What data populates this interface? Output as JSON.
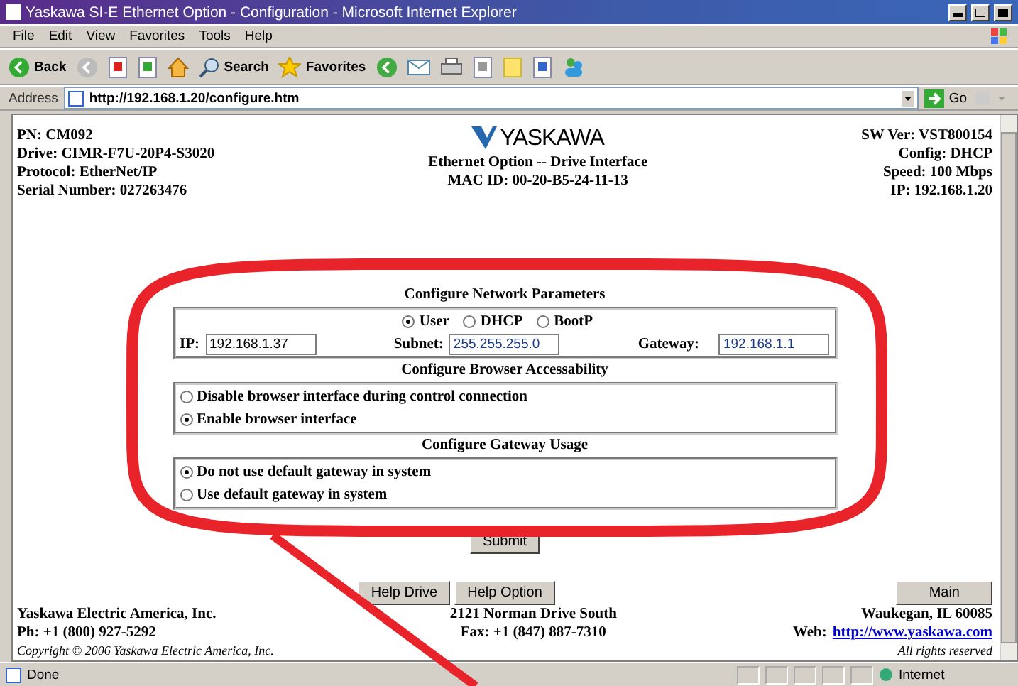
{
  "window": {
    "title": "Yaskawa SI-E Ethernet Option - Configuration - Microsoft Internet Explorer"
  },
  "menu": [
    "File",
    "Edit",
    "View",
    "Favorites",
    "Tools",
    "Help"
  ],
  "toolbar": {
    "back": "Back",
    "search": "Search",
    "favorites": "Favorites"
  },
  "address": {
    "label": "Address",
    "url": "http://192.168.1.20/configure.htm",
    "go": "Go"
  },
  "header": {
    "left": [
      "PN: CM092",
      "Drive: CIMR-F7U-20P4-S3020",
      "Protocol: EtherNet/IP",
      "Serial Number: 027263476"
    ],
    "logo": "YASKAWA",
    "center": [
      "Ethernet Option -- Drive Interface",
      "MAC ID: 00-20-B5-24-11-13"
    ],
    "right": [
      "SW Ver: VST800154",
      "Config: DHCP",
      "Speed: 100 Mbps",
      "IP: 192.168.1.20"
    ]
  },
  "network": {
    "title": "Configure Network Parameters",
    "modes": [
      {
        "label": "User",
        "selected": true
      },
      {
        "label": "DHCP",
        "selected": false
      },
      {
        "label": "BootP",
        "selected": false
      }
    ],
    "fields": [
      {
        "label": "IP:",
        "value": "192.168.1.37"
      },
      {
        "label": "Subnet:",
        "value": "255.255.255.0"
      },
      {
        "label": "Gateway:",
        "value": "192.168.1.1"
      }
    ]
  },
  "browser": {
    "title": "Configure Browser Accessability",
    "options": [
      {
        "label": "Disable browser interface during control connection",
        "selected": false
      },
      {
        "label": "Enable browser interface",
        "selected": true
      }
    ]
  },
  "gateway": {
    "title": "Configure Gateway Usage",
    "options": [
      {
        "label": "Do not use default gateway in system",
        "selected": true
      },
      {
        "label": "Use default gateway in system",
        "selected": false
      }
    ]
  },
  "submit": "Submit",
  "help_buttons": [
    "Help Drive",
    "Help Option"
  ],
  "main_button": "Main",
  "footer": {
    "left": [
      "Yaskawa Electric America, Inc.",
      "Ph: +1 (800) 927-5292"
    ],
    "copyright": "Copyright © 2006 Yaskawa Electric America, Inc.",
    "center": [
      "2121 Norman Drive South",
      "Fax: +1 (847) 887-7310"
    ],
    "right": "Waukegan, IL 60085",
    "web_label": "Web:",
    "web_link": "http://www.yaskawa.com",
    "rights": "All rights reserved"
  },
  "status_bar": {
    "text": "Done",
    "zone": "Internet"
  }
}
